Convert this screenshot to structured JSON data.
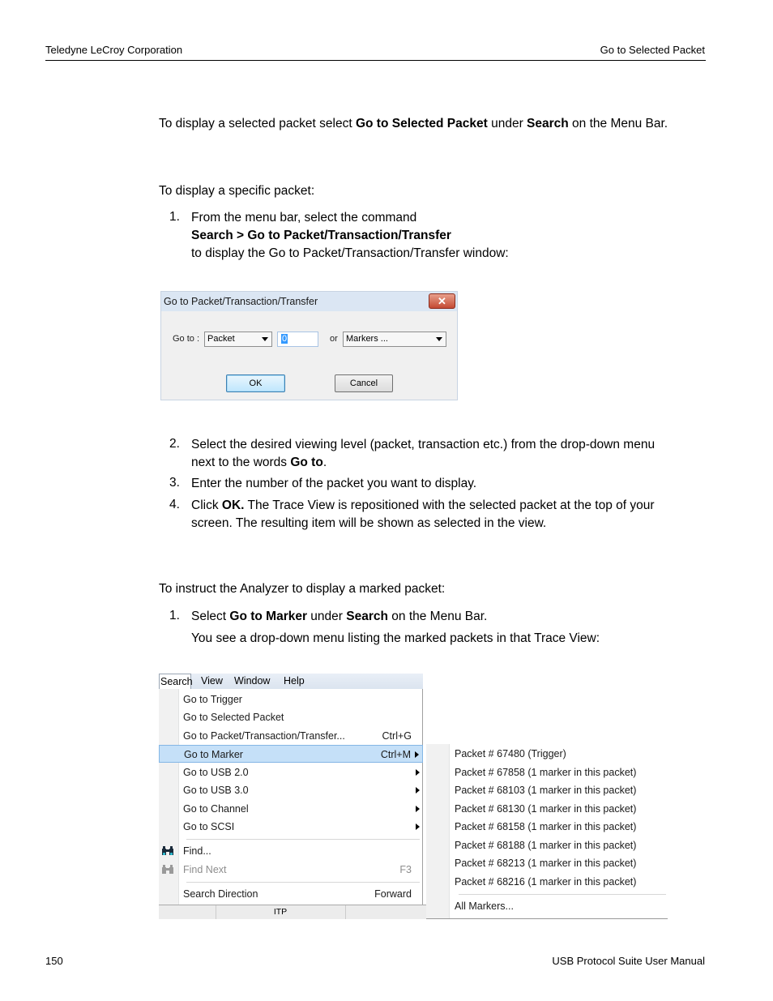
{
  "header": {
    "left": "Teledyne LeCroy Corporation",
    "right": "Go to Selected Packet"
  },
  "footer": {
    "page_number": "150",
    "manual": "USB Protocol Suite User Manual"
  },
  "section1": {
    "p1_a": "To display a selected packet select ",
    "p1_b": "Go to Selected Packet",
    "p1_c": " under ",
    "p1_d": "Search",
    "p1_e": " on the Menu Bar."
  },
  "section2": {
    "intro": "To display a specific packet:",
    "steps": [
      {
        "n": "1.",
        "line1": "From the menu bar, select the command",
        "line2": "Search > Go to Packet/Transaction/Transfer",
        "line3": "to display the Go to Packet/Transaction/Transfer window:"
      },
      {
        "n": "2.",
        "line1": "Select the desired viewing level (packet, transaction etc.) from the drop-down menu",
        "line2a": "next to the words ",
        "line2b": "Go to",
        "line2c": "."
      },
      {
        "n": "3.",
        "line1": "Enter the number of the packet you want to display."
      },
      {
        "n": "4.",
        "line1a": "Click ",
        "line1b": "OK.",
        "line1c": " The Trace View is repositioned with the selected packet at the top of your",
        "line2": "screen. The resulting item will be shown as selected in the view."
      }
    ]
  },
  "dialog": {
    "title": "Go to Packet/Transaction/Transfer",
    "close_icon": "close-icon",
    "goto_label": "Go to :",
    "level_value": "Packet",
    "number_value": "0",
    "or_label": "or",
    "markers_value": "Markers ...",
    "ok_label": "OK",
    "cancel_label": "Cancel"
  },
  "section3": {
    "intro": "To instruct the Analyzer to display a marked packet:",
    "step1_n": "1.",
    "step1_a": "Select ",
    "step1_b": "Go to Marker",
    "step1_c": " under ",
    "step1_d": "Search",
    "step1_e": " on the Menu Bar.",
    "step1_note": "You see a drop-down menu listing the marked packets in that Trace View:"
  },
  "menu": {
    "menubar": [
      "Search",
      "View",
      "Window",
      "Help"
    ],
    "items": [
      {
        "label": "Go to Trigger",
        "shortcut": ""
      },
      {
        "label": "Go to Selected Packet",
        "shortcut": ""
      },
      {
        "label": "Go to Packet/Transaction/Transfer...",
        "shortcut": "Ctrl+G"
      },
      {
        "label": "Go to Marker",
        "shortcut": "Ctrl+M"
      },
      {
        "label": "Go to USB 2.0",
        "shortcut": ""
      },
      {
        "label": "Go to USB 3.0",
        "shortcut": ""
      },
      {
        "label": "Go to Channel",
        "shortcut": ""
      },
      {
        "label": "Go to SCSI",
        "shortcut": ""
      },
      {
        "label": "Find...",
        "shortcut": "",
        "icon": "binoculars-icon"
      },
      {
        "label": "Find Next",
        "shortcut": "F3",
        "icon": "find-next-icon"
      },
      {
        "label": "Search Direction",
        "shortcut": "Forward"
      }
    ],
    "status_text": "ITP",
    "submenu": [
      "Packet # 67480 (Trigger)",
      "Packet # 67858 (1 marker in this packet)",
      "Packet # 68103 (1 marker in this packet)",
      "Packet # 68130 (1 marker in this packet)",
      "Packet # 68158 (1 marker in this packet)",
      "Packet # 68188 (1 marker in this packet)",
      "Packet # 68213 (1 marker in this packet)",
      "Packet # 68216 (1 marker in this packet)",
      "All Markers..."
    ]
  }
}
